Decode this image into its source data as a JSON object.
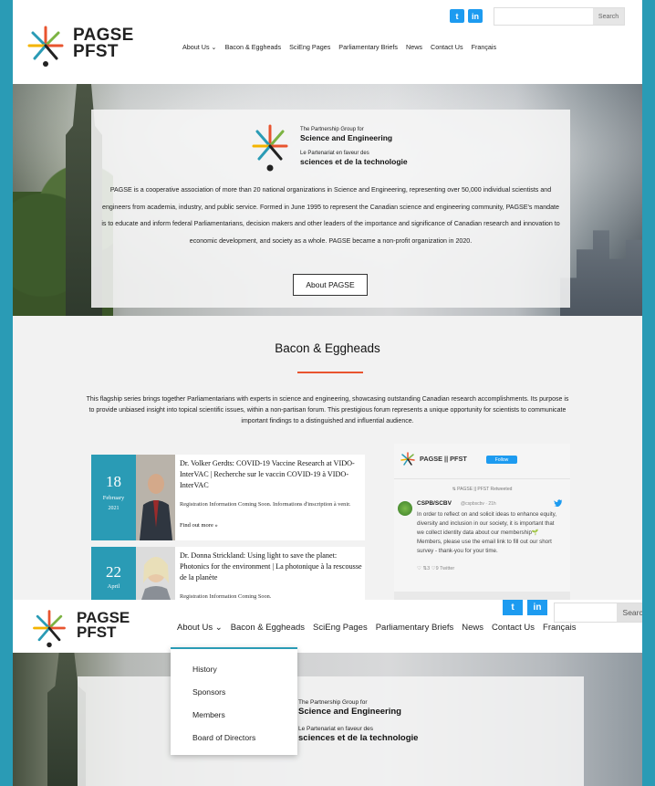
{
  "brand": {
    "line1": "PAGSE",
    "line2": "PFST"
  },
  "social": {
    "twitter": "t",
    "linkedin": "in"
  },
  "search": {
    "button_label": "Search",
    "placeholder": ""
  },
  "nav": {
    "items": [
      {
        "label": "About Us ⌄"
      },
      {
        "label": "Bacon & Eggheads"
      },
      {
        "label": "SciEng Pages"
      },
      {
        "label": "Parliamentary Briefs"
      },
      {
        "label": "News"
      },
      {
        "label": "Contact Us"
      },
      {
        "label": "Français"
      }
    ]
  },
  "hero": {
    "partner_small_en": "The Partnership Group for",
    "partner_big_en": "Science and Engineering",
    "partner_small_fr": "Le Partenariat en faveur des",
    "partner_big_fr": "sciences et de la technologie",
    "description": "PAGSE is a cooperative association of more than 20 national organizations in Science and Engineering, representing over 50,000 individual scientists and engineers from academia, industry, and public service. Formed in June 1995 to represent the Canadian science and engineering community, PAGSE's mandate is to educate and inform federal Parliamentarians, decision makers and other leaders of the importance and significance of Canadian research and innovation to economic development, and society as a whole. PAGSE became a non-profit organization in 2020.",
    "button_label": "About PAGSE"
  },
  "bacon": {
    "title": "Bacon & Eggheads",
    "description": "This flagship series brings together Parliamentarians with experts in science and engineering, showcasing outstanding Canadian research accomplishments. Its purpose is to provide unbiased insight into topical scientific issues, within a non-partisan forum. This prestigious forum represents a unique opportunity for scientists to communicate important findings to a distinguished and influential audience."
  },
  "events": [
    {
      "day": "18",
      "month": "February",
      "year": "2021",
      "title": "Dr. Volker Gerdts: COVID-19 Vaccine Research at VIDO-InterVAC | Recherche sur le vaccin COVID-19 à VIDO-InterVAC",
      "info": "Registration Information Coming Soon. Informations d'inscription à venir.",
      "more": "Find out more »"
    },
    {
      "day": "22",
      "month": "April",
      "year": "",
      "title": "Dr. Donna Strickland: Using light to save the planet: Photonics for the environment | La photonique à la rescousse de la planète",
      "info": "Registration Information Coming Soon.",
      "more": ""
    }
  ],
  "twitter": {
    "account": "PAGSE || PFST",
    "follow_label": "Follow",
    "retweeted": "⇅ PAGSE || PFST Retweeted",
    "tweet_user": "CSPB/SCBV",
    "tweet_handle": "@cspbscbv · 21h",
    "tweet_text": "In order to reflect on and solicit ideas to enhance equity, diversity and inclusion in our society, it is important that we collect identity data about our membership🌱 Members, please use the email link to fill out our short survey - thank-you for your time.",
    "tweet_actions": "♡  ⇅3  ♡9   Twitter"
  },
  "dropdown": {
    "items": [
      "History",
      "Sponsors",
      "Members",
      "Board of Directors"
    ]
  },
  "colors": {
    "frame": "#2a9bb5",
    "accent_rule": "#e8542f",
    "twitter_blue": "#1d9bf0"
  }
}
